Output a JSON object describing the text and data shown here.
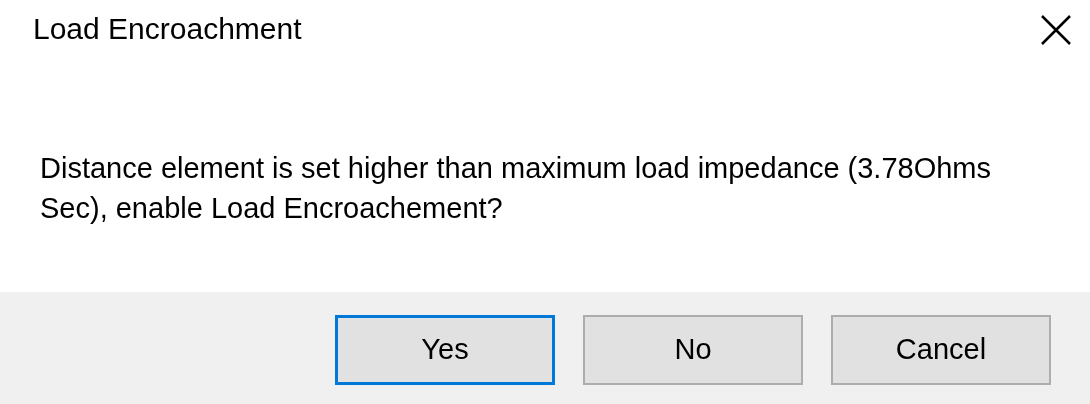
{
  "window": {
    "title": "Load Encroachment"
  },
  "message": "Distance element is set higher than maximum load impedance (3.78Ohms Sec), enable Load Encroachement?",
  "buttons": [
    {
      "label": "Yes",
      "focused": true
    },
    {
      "label": "No",
      "focused": false
    },
    {
      "label": "Cancel",
      "focused": false
    }
  ]
}
